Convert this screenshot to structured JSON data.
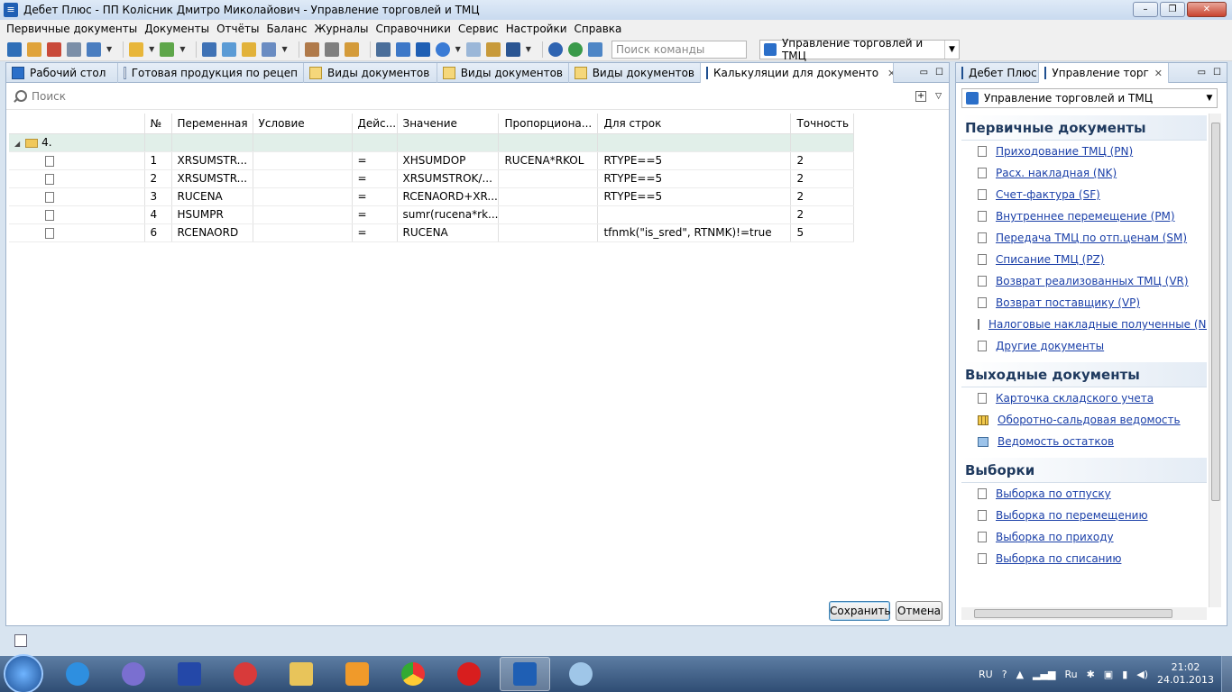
{
  "window": {
    "title": "Дебет Плюс - ПП Колісник Дмитро Миколайович - Управление торговлей и ТМЦ"
  },
  "menu": [
    "Первичные документы",
    "Документы",
    "Отчёты",
    "Баланс",
    "Журналы",
    "Справочники",
    "Сервис",
    "Настройки",
    "Справка"
  ],
  "toolbar": {
    "command_search_placeholder": "Поиск команды",
    "perspective": "Управление торговлей и ТМЦ"
  },
  "editor_tabs": [
    {
      "label": "Рабочий стол"
    },
    {
      "label": "Готовая продукция по рецеп"
    },
    {
      "label": "Виды документов"
    },
    {
      "label": "Виды документов"
    },
    {
      "label": "Виды документов"
    },
    {
      "label": "Калькуляции для документо"
    }
  ],
  "search": {
    "placeholder": "Поиск"
  },
  "table": {
    "columns": [
      "",
      "№",
      "Переменная",
      "Условие",
      "Дейс...",
      "Значение",
      "Пропорциона...",
      "Для строк",
      "Точность"
    ],
    "group_label": "4.",
    "rows": [
      {
        "n": "1",
        "var": "XRSUMSTR...",
        "cond": "",
        "act": "=",
        "value": "XHSUMDOP",
        "prop": "RUCENA*RKOL",
        "rows": "RTYPE==5",
        "prec": "2"
      },
      {
        "n": "2",
        "var": "XRSUMSTR...",
        "cond": "",
        "act": "=",
        "value": "XRSUMSTROK/...",
        "prop": "",
        "rows": "RTYPE==5",
        "prec": "2"
      },
      {
        "n": "3",
        "var": "RUCENA",
        "cond": "",
        "act": "=",
        "value": "RCENAORD+XR...",
        "prop": "",
        "rows": "RTYPE==5",
        "prec": "2"
      },
      {
        "n": "4",
        "var": "HSUMPR",
        "cond": "",
        "act": "=",
        "value": "sumr(rucena*rk...",
        "prop": "",
        "rows": "",
        "prec": "2"
      },
      {
        "n": "6",
        "var": "RCENAORD",
        "cond": "",
        "act": "=",
        "value": "RUCENA",
        "prop": "",
        "rows": "tfnmk(\"is_sred\", RTNMK)!=true",
        "prec": "5"
      }
    ]
  },
  "buttons": {
    "save": "Сохранить",
    "cancel": "Отмена"
  },
  "right_panel": {
    "tabs": [
      "Дебет Плюс",
      "Управление торг"
    ],
    "combo": "Управление торговлей и ТМЦ",
    "sections": [
      {
        "title": "Первичные документы",
        "items": [
          "Приходование ТМЦ (PN)",
          "Расх. накладная (NK)",
          "Счет-фактура (SF)",
          "Внутреннее перемещение (PM)",
          "Передача ТМЦ по отп.ценам (SM)",
          "Списание ТМЦ (PZ)",
          "Возврат реализованных ТМЦ (VR)",
          "Возврат поставщику (VP)",
          "Налоговые накладные полученные (NN)",
          "Другие документы"
        ]
      },
      {
        "title": "Выходные документы",
        "items": [
          "Карточка складского учета",
          "Оборотно-сальдовая ведомость",
          "Ведомость остатков"
        ]
      },
      {
        "title": "Выборки",
        "items": [
          "Выборка по отпуску",
          "Выборка по перемещению",
          "Выборка по приходу",
          "Выборка по списанию"
        ]
      }
    ]
  },
  "tray": {
    "lang": "RU",
    "kbd": "Ru",
    "time": "21:02",
    "date": "24.01.2013"
  }
}
